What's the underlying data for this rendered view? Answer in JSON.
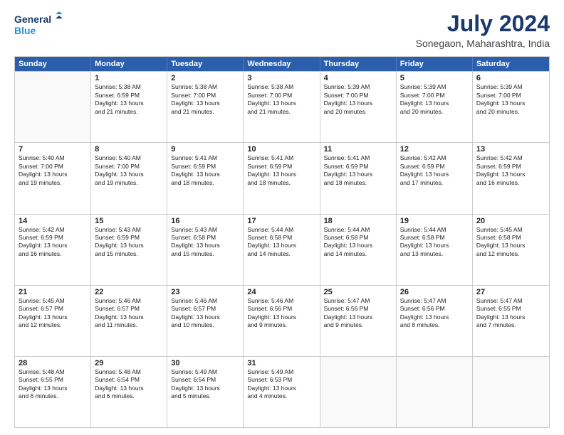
{
  "logo": {
    "line1": "General",
    "line2": "Blue"
  },
  "title": "July 2024",
  "subtitle": "Sonegaon, Maharashtra, India",
  "header": {
    "days": [
      "Sunday",
      "Monday",
      "Tuesday",
      "Wednesday",
      "Thursday",
      "Friday",
      "Saturday"
    ]
  },
  "weeks": [
    [
      {
        "day": "",
        "info": ""
      },
      {
        "day": "1",
        "info": "Sunrise: 5:38 AM\nSunset: 6:59 PM\nDaylight: 13 hours\nand 21 minutes."
      },
      {
        "day": "2",
        "info": "Sunrise: 5:38 AM\nSunset: 7:00 PM\nDaylight: 13 hours\nand 21 minutes."
      },
      {
        "day": "3",
        "info": "Sunrise: 5:38 AM\nSunset: 7:00 PM\nDaylight: 13 hours\nand 21 minutes."
      },
      {
        "day": "4",
        "info": "Sunrise: 5:39 AM\nSunset: 7:00 PM\nDaylight: 13 hours\nand 20 minutes."
      },
      {
        "day": "5",
        "info": "Sunrise: 5:39 AM\nSunset: 7:00 PM\nDaylight: 13 hours\nand 20 minutes."
      },
      {
        "day": "6",
        "info": "Sunrise: 5:39 AM\nSunset: 7:00 PM\nDaylight: 13 hours\nand 20 minutes."
      }
    ],
    [
      {
        "day": "7",
        "info": "Sunrise: 5:40 AM\nSunset: 7:00 PM\nDaylight: 13 hours\nand 19 minutes."
      },
      {
        "day": "8",
        "info": "Sunrise: 5:40 AM\nSunset: 7:00 PM\nDaylight: 13 hours\nand 19 minutes."
      },
      {
        "day": "9",
        "info": "Sunrise: 5:41 AM\nSunset: 6:59 PM\nDaylight: 13 hours\nand 18 minutes."
      },
      {
        "day": "10",
        "info": "Sunrise: 5:41 AM\nSunset: 6:59 PM\nDaylight: 13 hours\nand 18 minutes."
      },
      {
        "day": "11",
        "info": "Sunrise: 5:41 AM\nSunset: 6:59 PM\nDaylight: 13 hours\nand 18 minutes."
      },
      {
        "day": "12",
        "info": "Sunrise: 5:42 AM\nSunset: 6:59 PM\nDaylight: 13 hours\nand 17 minutes."
      },
      {
        "day": "13",
        "info": "Sunrise: 5:42 AM\nSunset: 6:59 PM\nDaylight: 13 hours\nand 16 minutes."
      }
    ],
    [
      {
        "day": "14",
        "info": "Sunrise: 5:42 AM\nSunset: 6:59 PM\nDaylight: 13 hours\nand 16 minutes."
      },
      {
        "day": "15",
        "info": "Sunrise: 5:43 AM\nSunset: 6:59 PM\nDaylight: 13 hours\nand 15 minutes."
      },
      {
        "day": "16",
        "info": "Sunrise: 5:43 AM\nSunset: 6:58 PM\nDaylight: 13 hours\nand 15 minutes."
      },
      {
        "day": "17",
        "info": "Sunrise: 5:44 AM\nSunset: 6:58 PM\nDaylight: 13 hours\nand 14 minutes."
      },
      {
        "day": "18",
        "info": "Sunrise: 5:44 AM\nSunset: 6:58 PM\nDaylight: 13 hours\nand 14 minutes."
      },
      {
        "day": "19",
        "info": "Sunrise: 5:44 AM\nSunset: 6:58 PM\nDaylight: 13 hours\nand 13 minutes."
      },
      {
        "day": "20",
        "info": "Sunrise: 5:45 AM\nSunset: 6:58 PM\nDaylight: 13 hours\nand 12 minutes."
      }
    ],
    [
      {
        "day": "21",
        "info": "Sunrise: 5:45 AM\nSunset: 6:57 PM\nDaylight: 13 hours\nand 12 minutes."
      },
      {
        "day": "22",
        "info": "Sunrise: 5:46 AM\nSunset: 6:57 PM\nDaylight: 13 hours\nand 11 minutes."
      },
      {
        "day": "23",
        "info": "Sunrise: 5:46 AM\nSunset: 6:57 PM\nDaylight: 13 hours\nand 10 minutes."
      },
      {
        "day": "24",
        "info": "Sunrise: 5:46 AM\nSunset: 6:56 PM\nDaylight: 13 hours\nand 9 minutes."
      },
      {
        "day": "25",
        "info": "Sunrise: 5:47 AM\nSunset: 6:56 PM\nDaylight: 13 hours\nand 9 minutes."
      },
      {
        "day": "26",
        "info": "Sunrise: 5:47 AM\nSunset: 6:56 PM\nDaylight: 13 hours\nand 8 minutes."
      },
      {
        "day": "27",
        "info": "Sunrise: 5:47 AM\nSunset: 6:55 PM\nDaylight: 13 hours\nand 7 minutes."
      }
    ],
    [
      {
        "day": "28",
        "info": "Sunrise: 5:48 AM\nSunset: 6:55 PM\nDaylight: 13 hours\nand 6 minutes."
      },
      {
        "day": "29",
        "info": "Sunrise: 5:48 AM\nSunset: 6:54 PM\nDaylight: 13 hours\nand 6 minutes."
      },
      {
        "day": "30",
        "info": "Sunrise: 5:49 AM\nSunset: 6:54 PM\nDaylight: 13 hours\nand 5 minutes."
      },
      {
        "day": "31",
        "info": "Sunrise: 5:49 AM\nSunset: 6:53 PM\nDaylight: 13 hours\nand 4 minutes."
      },
      {
        "day": "",
        "info": ""
      },
      {
        "day": "",
        "info": ""
      },
      {
        "day": "",
        "info": ""
      }
    ]
  ]
}
